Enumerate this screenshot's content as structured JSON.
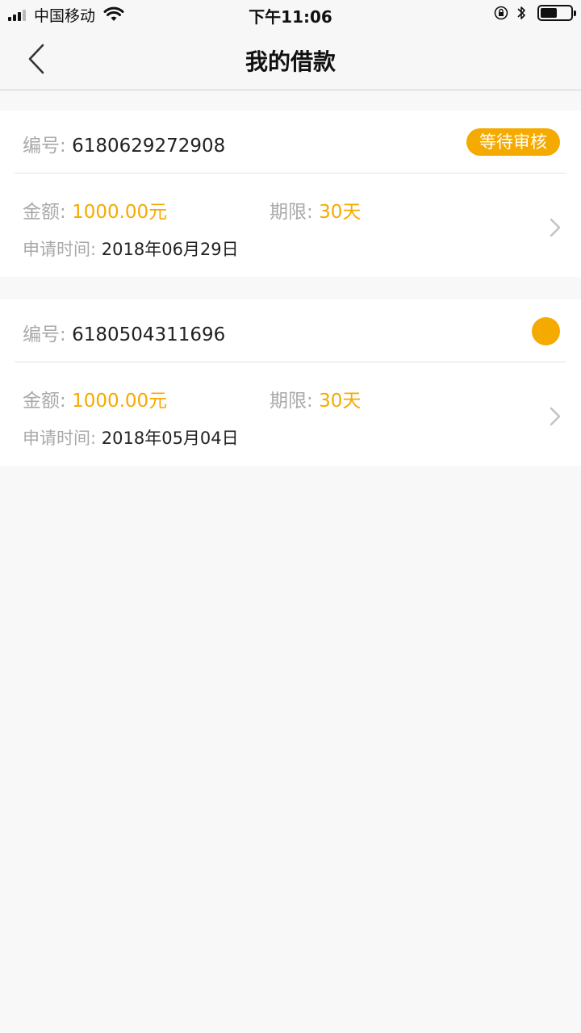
{
  "status_bar": {
    "carrier": "中国移动",
    "time": "下午11:06"
  },
  "nav": {
    "title": "我的借款",
    "back_icon": "chevron-left-icon"
  },
  "loans": [
    {
      "number_label": "编号:",
      "number": "6180629272908",
      "status": "等待审核",
      "amount_label": "金额:",
      "amount": "1000.00元",
      "term_label": "期限:",
      "term": "30天",
      "date_label": "申请时间:",
      "date": "2018年06月29日"
    },
    {
      "number_label": "编号:",
      "number": "6180504311696",
      "status": "",
      "amount_label": "金额:",
      "amount": "1000.00元",
      "term_label": "期限:",
      "term": "30天",
      "date_label": "申请时间:",
      "date": "2018年05月04日"
    }
  ],
  "colors": {
    "accent": "#f5aa00",
    "label_gray": "#a9a9a9",
    "background": "#f8f8f8"
  }
}
